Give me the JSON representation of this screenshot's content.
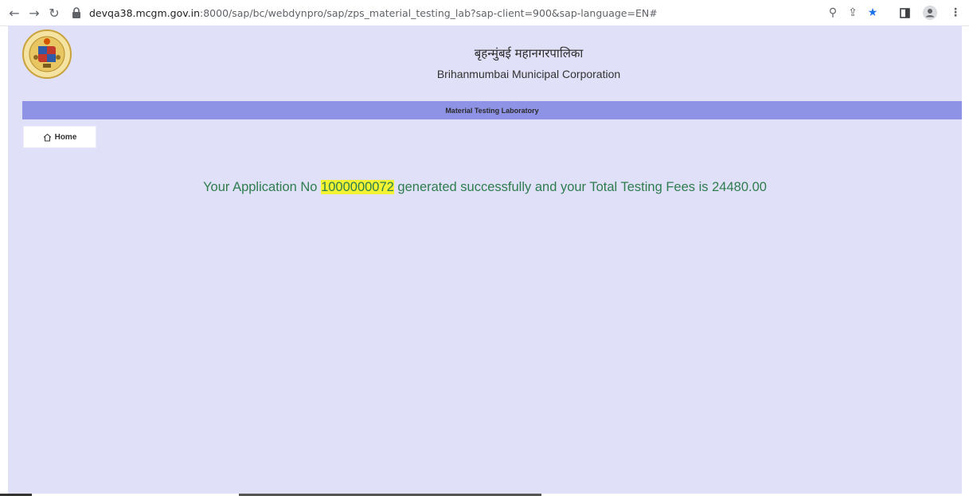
{
  "browser": {
    "url_host": "devqa38.mcgm.gov.in",
    "url_rest": ":8000/sap/bc/webdynpro/sap/zps_material_testing_lab?sap-client=900&sap-language=EN#"
  },
  "header": {
    "title_marathi": "बृहन्मुंबई महानगरपालिका",
    "title_english": "Brihanmumbai Municipal Corporation"
  },
  "lab_bar": {
    "title": "Material Testing Laboratory"
  },
  "nav": {
    "home_label": "Home"
  },
  "message": {
    "prefix": "Your Application No ",
    "application_no": "1000000072",
    "suffix": " generated successfully and your Total Testing Fees is 24480.00"
  },
  "colors": {
    "page_bg": "#e0e0f8",
    "lab_bar": "#8f93e6",
    "message_text": "#2e7d4f",
    "highlight": "#f0f232"
  }
}
